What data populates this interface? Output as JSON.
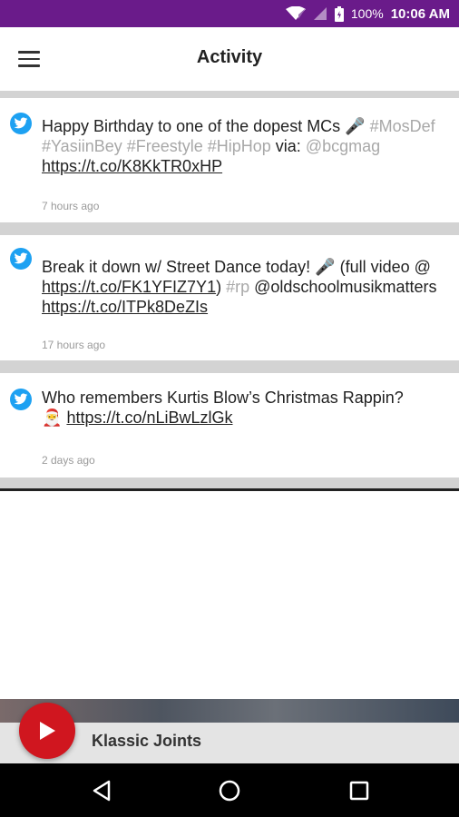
{
  "status_bar": {
    "battery": "100%",
    "time": "10:06 AM",
    "icons": [
      "wifi-icon",
      "signal-icon",
      "battery-icon"
    ],
    "background": "#6a1b8a"
  },
  "app_bar": {
    "title": "Activity",
    "menu_icon": "hamburger-menu-icon"
  },
  "feed": {
    "tweets": [
      {
        "text_plain_1": "Happy Birthday to one of the dopest MCs ",
        "hashtags": "#MosDef #YasiinBey #Freestyle #HipHop",
        "via": "  via:",
        "mention": "@bcgmag",
        "link": "https://t.co/K8KkTR0xHP",
        "time": "7 hours ago"
      },
      {
        "text_plain_1": "Break it down w/ Street Dance today! ",
        "text_plain_2": " (full video @ ",
        "link_1": "https://t.co/FK1YFIZ7Y1",
        "close_paren": ")",
        "hashtag": "#rp",
        "mention": "@oldschoolmusikmatters",
        "link_2": "https://t.co/ITPk8DeZIs",
        "time": "17 hours ago"
      },
      {
        "text_plain_1": "Who remembers Kurtis Blow’s Christmas Rappin?",
        "link": "https://t.co/nLiBwLzlGk",
        "time": "2 days ago"
      }
    ],
    "accent": "#1da1f2"
  },
  "player": {
    "title": "Klassic Joints",
    "accent": "#d0161f"
  },
  "nav_bar": {
    "icons": [
      "back-icon",
      "home-icon",
      "recents-icon"
    ]
  }
}
